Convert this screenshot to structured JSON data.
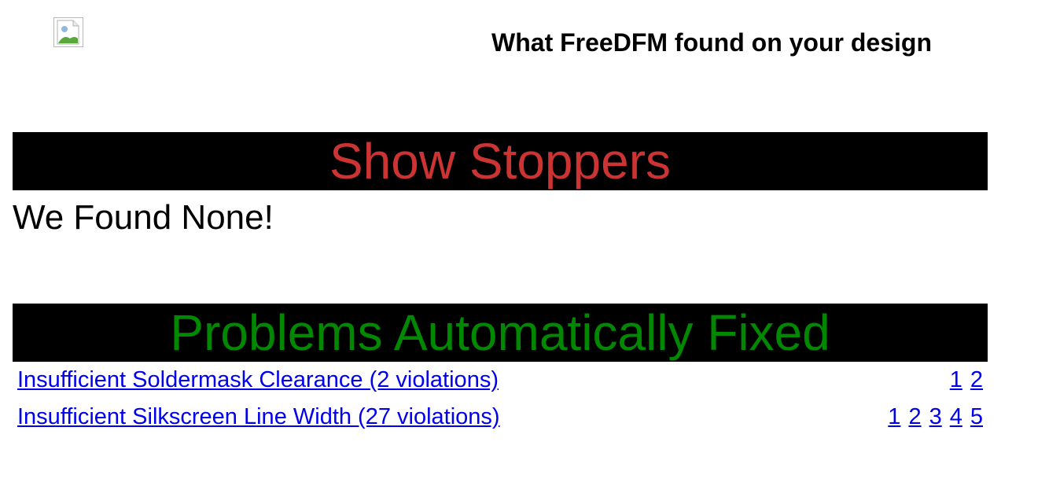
{
  "header": {
    "logo_icon": "broken-image-icon",
    "title": "What FreeDFM found on your design"
  },
  "show_stoppers": {
    "heading": "Show Stoppers",
    "heading_color": "#cc3333",
    "message": "We Found None!"
  },
  "auto_fixed": {
    "heading": "Problems Automatically Fixed",
    "heading_color": "#008800",
    "problems": [
      {
        "title": "Insufficient Soldermask Clearance (2 violations)",
        "pages": [
          "1",
          "2"
        ]
      },
      {
        "title": "Insufficient Silkscreen Line Width (27 violations)",
        "pages": [
          "1",
          "2",
          "3",
          "4",
          "5"
        ]
      }
    ]
  },
  "colors": {
    "banner_background": "#000000",
    "link": "#0000ee"
  }
}
